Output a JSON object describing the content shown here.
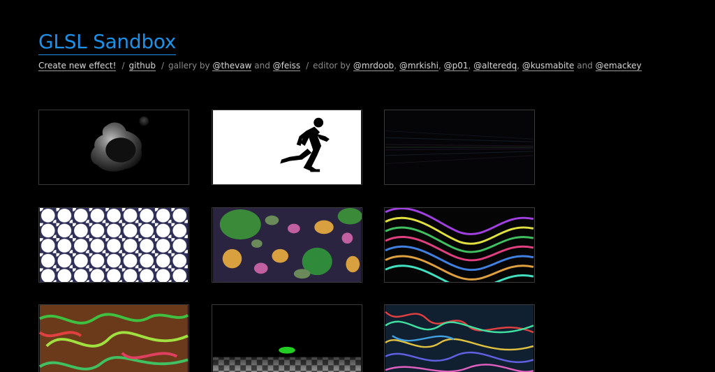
{
  "header": {
    "title": "GLSL Sandbox"
  },
  "links": {
    "create": "Create new effect!",
    "sep1": "/",
    "github": "github",
    "sep2": "/",
    "gallery_by": "gallery by",
    "thevaw": "@thevaw",
    "and1": "and",
    "feiss": "@feiss",
    "sep3": "/",
    "editor_by": "editor by",
    "mrdoob": "@mrdoob",
    "mrkishi": "@mrkishi",
    "p01": "@p01",
    "alteredq": "@alteredq",
    "kusmabite": "@kusmabite",
    "and2": "and",
    "emackey": "@emackey",
    "comma": ","
  },
  "gallery": {
    "thumbnails": [
      {
        "subject": "grey metaball blob"
      },
      {
        "subject": "running man silhouette"
      },
      {
        "subject": "dark noise lines"
      },
      {
        "subject": "white hexagon cells"
      },
      {
        "subject": "colored blobs"
      },
      {
        "subject": "rainbow spiral stripes"
      },
      {
        "subject": "green red swirl pattern"
      },
      {
        "subject": "checkerboard plane with green object"
      },
      {
        "subject": "colorful noise"
      }
    ]
  }
}
